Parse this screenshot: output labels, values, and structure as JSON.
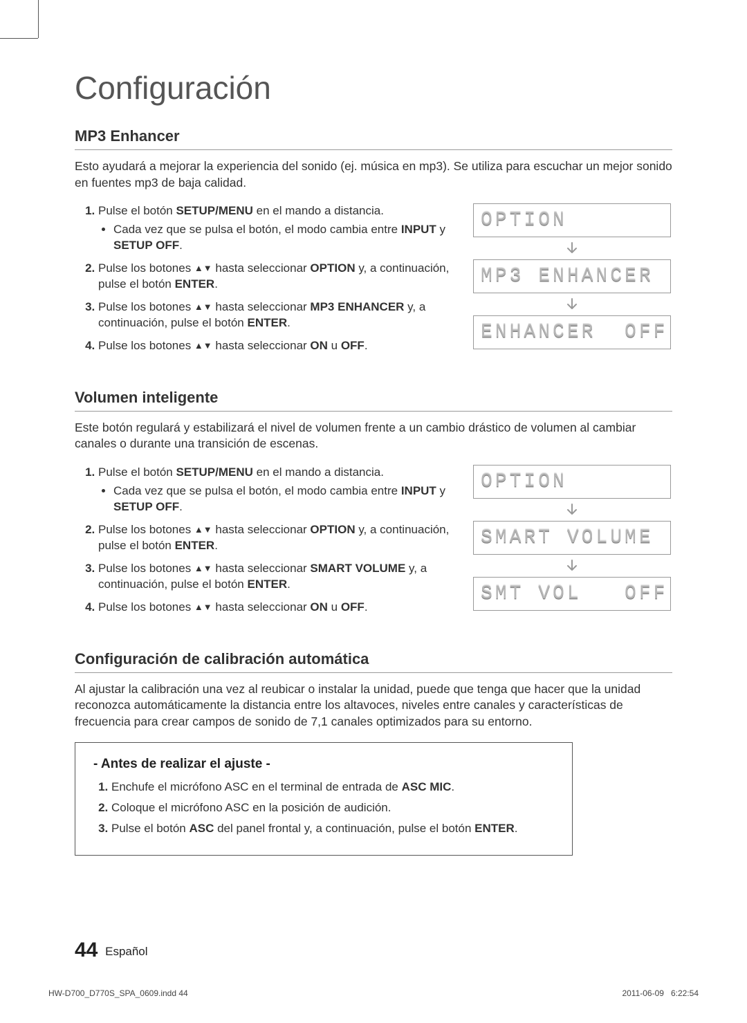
{
  "title": "Configuración",
  "sections": [
    {
      "heading": "MP3 Enhancer",
      "blurb": "Esto ayudará a mejorar la experiencia del sonido (ej. música en mp3). Se utiliza para escuchar un mejor sonido en fuentes mp3 de baja calidad.",
      "displays": [
        "OPTION",
        "MP3 ENHANCER",
        "ENHANCER  OFF"
      ]
    },
    {
      "heading": "Volumen inteligente",
      "blurb": "Este botón regulará y estabilizará el nivel de volumen frente a un cambio drástico de volumen al cambiar canales o durante una transición de escenas.",
      "displays": [
        "OPTION",
        "SMART VOLUME",
        "SMT VOL   OFF"
      ]
    },
    {
      "heading": "Configuración de calibración automática",
      "blurb": "Al ajustar la calibración una vez al reubicar o instalar la unidad, puede que tenga que hacer que la unidad reconozca automáticamente la distancia entre los altavoces, niveles entre canales y características de frecuencia para crear campos de sonido de 7,1 canales optimizados para su entorno."
    }
  ],
  "steps_common": {
    "s1_pre": "Pulse el botón ",
    "s1_bold": "SETUP/MENU",
    "s1_post": " en el mando a distancia.",
    "s1_sub_pre": "Cada vez que se pulsa el botón, el modo cambia entre ",
    "s1_sub_b1": "INPUT",
    "s1_sub_mid": " y ",
    "s1_sub_b2": "SETUP OFF",
    "s2_pre": "Pulse los botones ",
    "s2_mid": " hasta seleccionar ",
    "s2_b": "OPTION",
    "s2_post": " y, a continuación, pulse el botón ",
    "s2_enter": "ENTER",
    "s3_pre": "Pulse los botones ",
    "s3_mid": " hasta seleccionar ",
    "s3_post": " y, a continuación, pulse el botón ",
    "s3_enter": "ENTER",
    "s4_pre": "Pulse los botones ",
    "s4_mid": " hasta seleccionar ",
    "s4_b1": "ON",
    "s4_or": " u ",
    "s4_b2": "OFF"
  },
  "s3_target_a": "MP3 ENHANCER",
  "s3_target_b": "SMART VOLUME",
  "callout": {
    "title": "- Antes de realizar el ajuste -",
    "i1_pre": "Enchufe el micrófono ASC en el terminal de entrada de ",
    "i1_b": "ASC MIC",
    "i2": "Coloque el micrófono ASC en la posición de audición.",
    "i3_pre": "Pulse el botón ",
    "i3_b1": "ASC",
    "i3_mid": " del panel frontal y, a continuación, pulse el botón ",
    "i3_b2": "ENTER"
  },
  "footer": {
    "page_no": "44",
    "lang": "Español"
  },
  "print": {
    "left": "HW-D700_D770S_SPA_0609.indd   44",
    "date": "2011-06-09",
    "time": "6:22:54"
  }
}
